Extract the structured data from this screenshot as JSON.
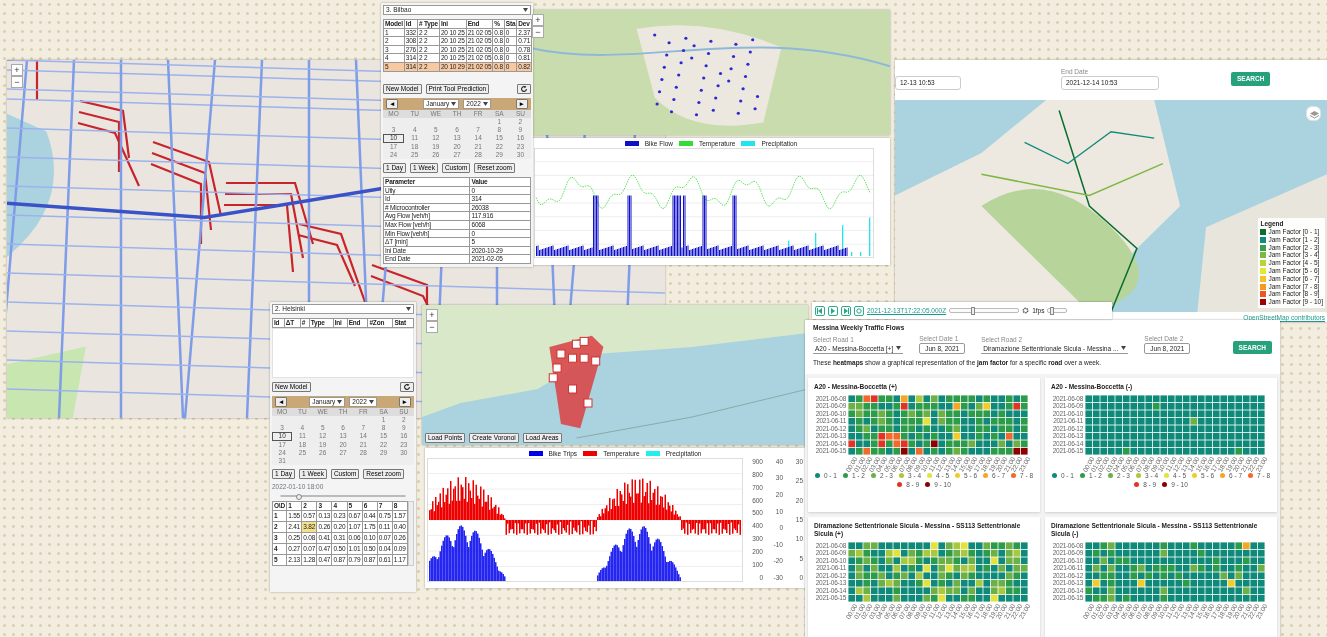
{
  "background_map": {
    "zoom_in": "+",
    "zoom_out": "−"
  },
  "bilbao_panel": {
    "dropdown": "3. Bilbao",
    "columns": [
      "Model",
      "Id",
      "# Type",
      "Ini",
      "End",
      "%",
      "Sta",
      "Dev"
    ],
    "rows": [
      {
        "cells": [
          "1",
          "332",
          "2 2",
          "20 10 25",
          "21 02 05",
          "0.8",
          "0",
          "2.37"
        ],
        "selected": false
      },
      {
        "cells": [
          "2",
          "308",
          "2 2",
          "20 10 25",
          "21 02 05",
          "0.8",
          "0",
          "0.71"
        ],
        "selected": false
      },
      {
        "cells": [
          "3",
          "276",
          "2 2",
          "20 10 25",
          "21 02 05",
          "0.8",
          "0",
          "0.78"
        ],
        "selected": false
      },
      {
        "cells": [
          "4",
          "314",
          "2 2",
          "20 10 25",
          "21 02 05",
          "0.8",
          "0",
          "0.81"
        ],
        "selected": false
      },
      {
        "cells": [
          "5",
          "314",
          "2 2",
          "20 10 29",
          "21 02 05",
          "0.8",
          "0",
          "0.82"
        ],
        "selected": true
      }
    ],
    "buttons": [
      "New Model",
      "Print Tool Prediction"
    ],
    "calendar": {
      "prev": "◄",
      "next": "►",
      "month": "January",
      "year": "2022",
      "weekdays": [
        "MO",
        "TU",
        "WE",
        "TH",
        "FR",
        "SA",
        "SU"
      ],
      "weeks": [
        [
          {
            "day": "1",
            "selected": false
          },
          {
            "day": "2",
            "selected": false
          }
        ],
        [
          {
            "day": "3",
            "selected": false
          },
          {
            "day": "4",
            "selected": false
          },
          {
            "day": "5",
            "selected": false
          },
          {
            "day": "6",
            "selected": false
          },
          {
            "day": "7",
            "selected": false
          },
          {
            "day": "8",
            "selected": false
          },
          {
            "day": "9",
            "selected": false
          }
        ],
        [
          {
            "day": "10",
            "selected": true
          },
          {
            "day": "11",
            "selected": false
          },
          {
            "day": "12",
            "selected": false
          },
          {
            "day": "13",
            "selected": false
          },
          {
            "day": "14",
            "selected": false
          },
          {
            "day": "15",
            "selected": false
          },
          {
            "day": "16",
            "selected": false
          }
        ],
        [
          {
            "day": "17",
            "selected": false
          },
          {
            "day": "18",
            "selected": false
          },
          {
            "day": "19",
            "selected": false
          },
          {
            "day": "20",
            "selected": false
          },
          {
            "day": "21",
            "selected": false
          },
          {
            "day": "22",
            "selected": false
          },
          {
            "day": "23",
            "selected": false
          }
        ],
        [
          {
            "day": "24",
            "selected": false
          },
          {
            "day": "25",
            "selected": false
          },
          {
            "day": "26",
            "selected": false
          },
          {
            "day": "27",
            "selected": false
          },
          {
            "day": "28",
            "selected": false
          },
          {
            "day": "29",
            "selected": false
          },
          {
            "day": "30",
            "selected": false
          }
        ]
      ]
    },
    "range_buttons": [
      "1 Day",
      "1 Week",
      "Custom",
      "Reset zoom"
    ],
    "parameters": {
      "columns": [
        "Parameter",
        "Value"
      ],
      "rows": [
        [
          "Utly",
          "0"
        ],
        [
          "Id",
          "314"
        ],
        [
          "# Microcontroller",
          "26038"
        ],
        [
          "Avg Flow [veh/h]",
          "117.916"
        ],
        [
          "Max Flow [veh/h]",
          "6068"
        ],
        [
          "Min Flow [veh/h]",
          "0"
        ],
        [
          "ΔT [min]",
          "5"
        ],
        [
          "Ini Date",
          "2020-10-29"
        ],
        [
          "End Date",
          "2021-02-05"
        ]
      ]
    }
  },
  "bilbao_map": {
    "zoom_in": "+",
    "zoom_out": "−"
  },
  "bilbao_chart": {
    "legend": [
      {
        "name": "Bike Flow",
        "color": "#1010c8"
      },
      {
        "name": "Temperature",
        "color": "#33dd33"
      },
      {
        "name": "Precipitation",
        "color": "#22e4ec"
      }
    ]
  },
  "helsinki_panel": {
    "dropdown": "2. Helsinki",
    "columns": [
      "Id",
      "ΔT",
      "#",
      "Type",
      "Ini",
      "End",
      "#Zon",
      "Stat"
    ],
    "buttons": [
      "New Model"
    ],
    "calendar": {
      "prev": "◄",
      "next": "►",
      "month": "January",
      "year": "2022",
      "weekdays": [
        "MO",
        "TU",
        "WE",
        "TH",
        "FR",
        "SA",
        "SU"
      ],
      "weeks": [
        [
          {
            "day": "1",
            "selected": false
          },
          {
            "day": "2",
            "selected": false
          }
        ],
        [
          {
            "day": "3",
            "selected": false
          },
          {
            "day": "4",
            "selected": false
          },
          {
            "day": "5",
            "selected": false
          },
          {
            "day": "6",
            "selected": false
          },
          {
            "day": "7",
            "selected": false
          },
          {
            "day": "8",
            "selected": false
          },
          {
            "day": "9",
            "selected": false
          }
        ],
        [
          {
            "day": "10",
            "selected": true
          },
          {
            "day": "11",
            "selected": false
          },
          {
            "day": "12",
            "selected": false
          },
          {
            "day": "13",
            "selected": false
          },
          {
            "day": "14",
            "selected": false
          },
          {
            "day": "15",
            "selected": false
          },
          {
            "day": "16",
            "selected": false
          }
        ],
        [
          {
            "day": "17",
            "selected": false
          },
          {
            "day": "18",
            "selected": false
          },
          {
            "day": "19",
            "selected": false
          },
          {
            "day": "20",
            "selected": false
          },
          {
            "day": "21",
            "selected": false
          },
          {
            "day": "22",
            "selected": false
          },
          {
            "day": "23",
            "selected": false
          }
        ],
        [
          {
            "day": "24",
            "selected": false
          },
          {
            "day": "25",
            "selected": false
          },
          {
            "day": "26",
            "selected": false
          },
          {
            "day": "27",
            "selected": false
          },
          {
            "day": "28",
            "selected": false
          },
          {
            "day": "29",
            "selected": false
          },
          {
            "day": "30",
            "selected": false
          }
        ],
        [
          {
            "day": "31",
            "selected": false
          }
        ]
      ]
    },
    "range_buttons": [
      "1 Day",
      "1 Week",
      "Custom",
      "Reset zoom"
    ],
    "timestamp": "2022-01-10 18:00",
    "time_slider": {
      "level": 0.12
    },
    "matrix": {
      "corner": "O\\D",
      "columns": [
        "1",
        "2",
        "3",
        "4",
        "5",
        "6",
        "7",
        "8"
      ],
      "rows": [
        {
          "label": "1",
          "cells": [
            {
              "value": "1.55",
              "selected": false
            },
            {
              "value": "0.57",
              "selected": false
            },
            {
              "value": "0.13",
              "selected": false
            },
            {
              "value": "0.23",
              "selected": false
            },
            {
              "value": "0.67",
              "selected": false
            },
            {
              "value": "0.44",
              "selected": false
            },
            {
              "value": "0.75",
              "selected": false
            },
            {
              "value": "1.57",
              "selected": false
            }
          ]
        },
        {
          "label": "2",
          "cells": [
            {
              "value": "2.41",
              "selected": false
            },
            {
              "value": "3.82",
              "selected": true
            },
            {
              "value": "0.26",
              "selected": false
            },
            {
              "value": "0.20",
              "selected": false
            },
            {
              "value": "1.07",
              "selected": false
            },
            {
              "value": "1.75",
              "selected": false
            },
            {
              "value": "0.11",
              "selected": false
            },
            {
              "value": "0.40",
              "selected": false
            }
          ]
        },
        {
          "label": "3",
          "cells": [
            {
              "value": "0.25",
              "selected": false
            },
            {
              "value": "0.08",
              "selected": false
            },
            {
              "value": "0.41",
              "selected": false
            },
            {
              "value": "0.31",
              "selected": false
            },
            {
              "value": "0.06",
              "selected": false
            },
            {
              "value": "0.10",
              "selected": false
            },
            {
              "value": "0.07",
              "selected": false
            },
            {
              "value": "0.26",
              "selected": false
            }
          ]
        },
        {
          "label": "4",
          "cells": [
            {
              "value": "0.27",
              "selected": false
            },
            {
              "value": "0.07",
              "selected": false
            },
            {
              "value": "0.47",
              "selected": false
            },
            {
              "value": "0.50",
              "selected": false
            },
            {
              "value": "1.01",
              "selected": false
            },
            {
              "value": "0.50",
              "selected": false
            },
            {
              "value": "0.04",
              "selected": false
            },
            {
              "value": "0.09",
              "selected": false
            }
          ]
        },
        {
          "label": "5",
          "cells": [
            {
              "value": "2.13",
              "selected": false
            },
            {
              "value": "1.28",
              "selected": false
            },
            {
              "value": "0.47",
              "selected": false
            },
            {
              "value": "0.87",
              "selected": false
            },
            {
              "value": "0.79",
              "selected": false
            },
            {
              "value": "0.87",
              "selected": false
            },
            {
              "value": "0.61",
              "selected": false
            },
            {
              "value": "1.17",
              "selected": false
            }
          ]
        }
      ]
    }
  },
  "helsinki_map": {
    "zoom_in": "+",
    "zoom_out": "−",
    "buttons": [
      "Load Points",
      "Create Voronoi",
      "Load Areas"
    ]
  },
  "helsinki_chart": {
    "legend": [
      {
        "name": "Bike Trips",
        "color": "#0000ee"
      },
      {
        "name": "Temperature",
        "color": "#ee0000"
      },
      {
        "name": "Precipitation",
        "color": "#22eeee"
      }
    ],
    "y1_ticks": [
      "900",
      "800",
      "700",
      "600",
      "500",
      "400",
      "300",
      "200",
      "100",
      "0"
    ],
    "y2_ticks": [
      "40",
      "30",
      "20",
      "10",
      "0",
      "-10",
      "-20",
      "-30"
    ],
    "y3_ticks": [
      "30",
      "25",
      "20",
      "15",
      "10",
      "5",
      "0"
    ]
  },
  "messina_map": {
    "start_value": "12-13 10:53",
    "end_label": "End Date",
    "end_value": "2021-12-14 10:53",
    "search": "SEARCH",
    "legend": {
      "title": "Legend",
      "items": [
        {
          "label": "Jam Factor [0 - 1]",
          "color": "#0b6e2e"
        },
        {
          "label": "Jam Factor [1 - 2]",
          "color": "#138a7e"
        },
        {
          "label": "Jam Factor [2 - 3]",
          "color": "#3aa04a"
        },
        {
          "label": "Jam Factor [3 - 4]",
          "color": "#7db843"
        },
        {
          "label": "Jam Factor [4 - 5]",
          "color": "#b8d43a"
        },
        {
          "label": "Jam Factor [5 - 6]",
          "color": "#e6e63a"
        },
        {
          "label": "Jam Factor [6 - 7]",
          "color": "#f5c02a"
        },
        {
          "label": "Jam Factor [7 - 8]",
          "color": "#f59a1e"
        },
        {
          "label": "Jam Factor [8 - 9]",
          "color": "#ee5522"
        },
        {
          "label": "Jam Factor [9 - 10]",
          "color": "#a00000"
        }
      ]
    },
    "time_link": "2021-12-13T17:22:05.000Z",
    "time_slider": {
      "level": 0.3
    },
    "fps": "1fps",
    "fps_slider": {
      "level": 0.1
    },
    "attribution": "OpenStreetMap contributors"
  },
  "weekly": {
    "title": "Messina Weekly Traffic Flows",
    "fields": [
      {
        "label": "Select Road 1",
        "value": "A20 - Messina-Boccetta [+]",
        "kind": "select"
      },
      {
        "label": "Select Date 1",
        "value": "Jun 8, 2021",
        "kind": "date"
      },
      {
        "label": "Select Road 2",
        "value": "Diramazione Settentrionale Sicula - Messina ...",
        "kind": "select"
      },
      {
        "label": "Select Date 2",
        "value": "Jun 8, 2021",
        "kind": "date"
      }
    ],
    "search": "SEARCH",
    "intro": "These **heatmaps** show a graphical representation of the **jam factor** for a specific **road** over a week.",
    "cards": [
      {
        "title": "A20 - Messina-Boccetta (+)",
        "dates": [
          "2021-06-08",
          "2021-06-09",
          "2021-06-10",
          "2021-06-11",
          "2021-06-12",
          "2021-06-13",
          "2021-06-14",
          "2021-06-15"
        ],
        "hours": [
          "00:00",
          "01:00",
          "02:00",
          "03:00",
          "04:00",
          "05:00",
          "06:00",
          "07:00",
          "08:00",
          "09:00",
          "10:00",
          "11:00",
          "12:00",
          "13:00",
          "14:00",
          "15:00",
          "16:00",
          "17:00",
          "18:00",
          "19:00",
          "20:00",
          "21:00",
          "22:00",
          "23:00"
        ],
        "legend": [
          {
            "label": "0 - 1",
            "color": "#0f8a7a"
          },
          {
            "label": "1 - 2",
            "color": "#2c9c4a"
          },
          {
            "label": "2 - 3",
            "color": "#6db045"
          },
          {
            "label": "3 - 4",
            "color": "#a9c83d"
          },
          {
            "label": "4 - 5",
            "color": "#e3e33c"
          },
          {
            "label": "5 - 6",
            "color": "#f2cc2b"
          },
          {
            "label": "6 - 7",
            "color": "#f5a623"
          },
          {
            "label": "7 - 8",
            "color": "#f26a2b"
          },
          {
            "label": "8 - 9",
            "color": "#e23424"
          },
          {
            "label": "9 - 10",
            "color": "#8b0000"
          }
        ]
      },
      {
        "title": "A20 - Messina-Boccetta (-)",
        "dates": [
          "2021-06-08",
          "2021-06-09",
          "2021-06-10",
          "2021-06-11",
          "2021-06-12",
          "2021-06-13",
          "2021-06-14",
          "2021-06-15"
        ],
        "hours": [
          "00:00",
          "01:00",
          "02:00",
          "03:00",
          "04:00",
          "05:00",
          "06:00",
          "07:00",
          "08:00",
          "09:00",
          "10:00",
          "11:00",
          "12:00",
          "13:00",
          "14:00",
          "15:00",
          "16:00",
          "17:00",
          "18:00",
          "19:00",
          "20:00",
          "21:00",
          "22:00",
          "23:00"
        ],
        "legend": [
          {
            "label": "0 - 1",
            "color": "#0f8a7a"
          },
          {
            "label": "1 - 2",
            "color": "#2c9c4a"
          },
          {
            "label": "2 - 3",
            "color": "#6db045"
          },
          {
            "label": "3 - 4",
            "color": "#a9c83d"
          },
          {
            "label": "4 - 5",
            "color": "#e3e33c"
          },
          {
            "label": "5 - 6",
            "color": "#f2cc2b"
          },
          {
            "label": "6 - 7",
            "color": "#f5a623"
          },
          {
            "label": "7 - 8",
            "color": "#f26a2b"
          },
          {
            "label": "8 - 9",
            "color": "#e23424"
          },
          {
            "label": "9 - 10",
            "color": "#8b0000"
          }
        ]
      },
      {
        "title": "Diramazione Settentrionale Sicula - Messina - SS113 Settentrionale Sicula (+)",
        "dates": [
          "2021-06-08",
          "2021-06-09",
          "2021-06-10",
          "2021-06-11",
          "2021-06-12",
          "2021-06-13",
          "2021-06-14",
          "2021-06-15"
        ],
        "hours": [
          "00:00",
          "01:00",
          "02:00",
          "03:00",
          "04:00",
          "05:00",
          "06:00",
          "07:00",
          "08:00",
          "09:00",
          "10:00",
          "11:00",
          "12:00",
          "13:00",
          "14:00",
          "15:00",
          "16:00",
          "17:00",
          "18:00",
          "19:00",
          "20:00",
          "21:00",
          "22:00",
          "23:00"
        ]
      },
      {
        "title": "Diramazione Settentrionale Sicula - Messina - SS113 Settentrionale Sicula (-)",
        "dates": [
          "2021-06-08",
          "2021-06-09",
          "2021-06-10",
          "2021-06-11",
          "2021-06-12",
          "2021-06-13",
          "2021-06-14",
          "2021-06-15"
        ],
        "hours": [
          "00:00",
          "01:00",
          "02:00",
          "03:00",
          "04:00",
          "05:00",
          "06:00",
          "07:00",
          "08:00",
          "09:00",
          "10:00",
          "11:00",
          "12:00",
          "13:00",
          "14:00",
          "15:00",
          "16:00",
          "17:00",
          "18:00",
          "19:00",
          "20:00",
          "21:00",
          "22:00",
          "23:00"
        ]
      }
    ]
  }
}
